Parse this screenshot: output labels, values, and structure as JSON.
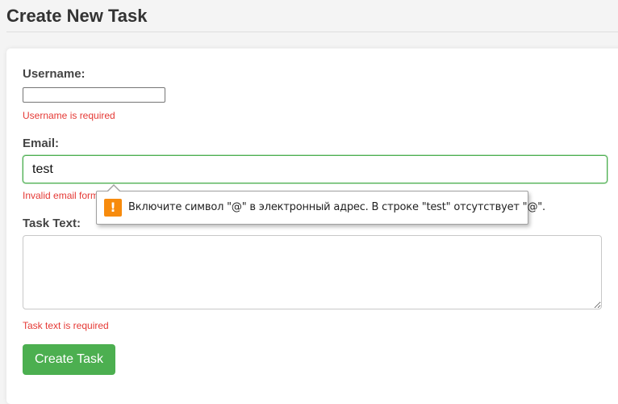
{
  "page": {
    "title": "Create New Task"
  },
  "form": {
    "username": {
      "label": "Username:",
      "value": "",
      "error": "Username is required"
    },
    "email": {
      "label": "Email:",
      "value": "test",
      "error": "Invalid email format"
    },
    "task_text": {
      "label": "Task Text:",
      "value": "",
      "error": "Task text is required"
    },
    "submit_label": "Create Task"
  },
  "validation_tooltip": {
    "icon": "warning-icon",
    "icon_glyph": "!",
    "message": "Включите символ \"@\" в электронный адрес. В строке \"test\" отсутствует \"@\"."
  },
  "colors": {
    "accent": "#4caf50",
    "error": "#e53935",
    "warning": "#f78b0d"
  }
}
